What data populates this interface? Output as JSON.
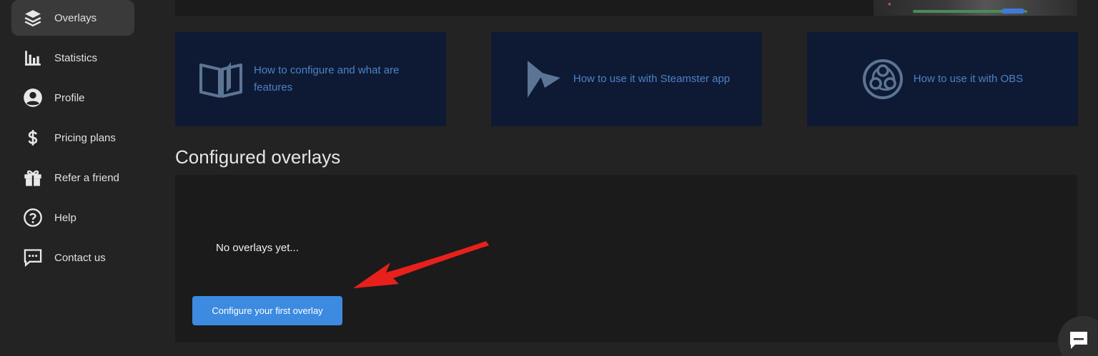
{
  "sidebar": {
    "items": [
      {
        "label": "Overlays",
        "icon": "layers-icon",
        "active": true
      },
      {
        "label": "Statistics",
        "icon": "bar-chart-icon"
      },
      {
        "label": "Profile",
        "icon": "user-circle-icon"
      },
      {
        "label": "Pricing plans",
        "icon": "dollar-icon"
      },
      {
        "label": "Refer a friend",
        "icon": "gift-icon"
      },
      {
        "label": "Help",
        "icon": "help-circle-icon"
      },
      {
        "label": "Contact us",
        "icon": "chat-icon"
      }
    ]
  },
  "help_cards": [
    {
      "label": "How to configure and what are features",
      "icon": "book-icon"
    },
    {
      "label": "How to use it with Steamster app",
      "icon": "steamster-logo-icon"
    },
    {
      "label": "How to use it with OBS",
      "icon": "obs-logo-icon"
    }
  ],
  "configured": {
    "title": "Configured overlays",
    "empty_text": "No overlays yet...",
    "cta_label": "Configure your first overlay"
  },
  "colors": {
    "accent": "#3d8be0",
    "card_bg": "#0e1a33",
    "card_text": "#4a82c9",
    "annotation": "#e8201c"
  }
}
